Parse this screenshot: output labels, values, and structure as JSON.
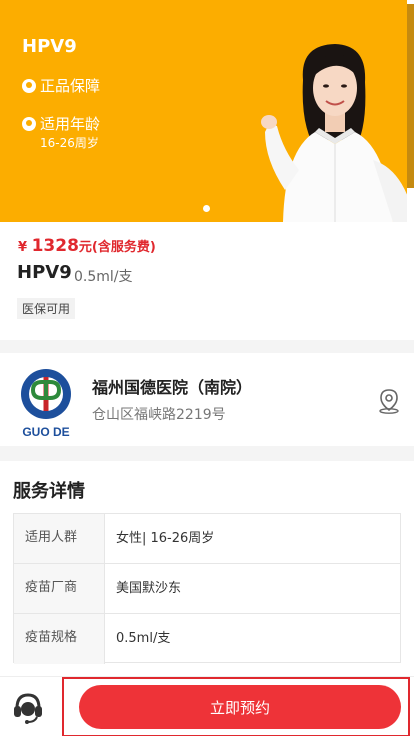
{
  "banner": {
    "title": "HPV9",
    "feature1": "正品保障",
    "feature2": "适用年龄",
    "age_range": "16-26周岁"
  },
  "product": {
    "price_symbol": "¥",
    "price_value": "1328",
    "price_note": "元(含服务费)",
    "name": "HPV9",
    "spec": "0.5ml/支",
    "tag": "医保可用"
  },
  "hospital": {
    "logo_text": "GUO DE",
    "name": "福州国德医院（南院）",
    "address": "仓山区福峡路2219号"
  },
  "service": {
    "title": "服务详情",
    "rows": [
      {
        "key": "适用人群",
        "value": "女性| 16-26周岁"
      },
      {
        "key": "疫苗厂商",
        "value": "美国默沙东"
      },
      {
        "key": "疫苗规格",
        "value": "0.5ml/支"
      }
    ]
  },
  "bottom": {
    "book_label": "立即预约"
  },
  "colors": {
    "banner": "#fcad00",
    "accent": "#e0282e",
    "button": "#ee3338"
  }
}
